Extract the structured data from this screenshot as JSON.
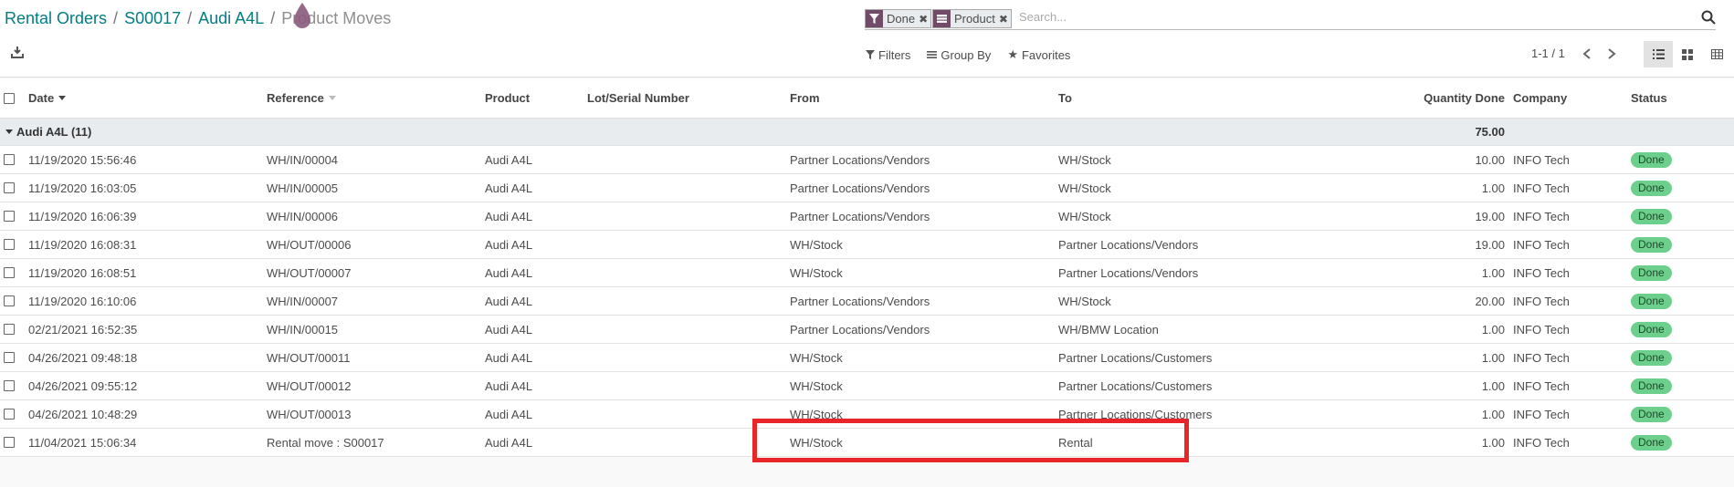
{
  "breadcrumb": {
    "items": [
      "Rental Orders",
      "S00017",
      "Audi A4L"
    ],
    "separator": "/",
    "current": "Product Moves"
  },
  "search": {
    "facets": [
      {
        "icon": "filter-icon",
        "label": "Done"
      },
      {
        "icon": "group-icon",
        "label": "Product"
      }
    ],
    "placeholder": "Search..."
  },
  "controls": {
    "filters": "Filters",
    "group_by": "Group By",
    "favorites": "Favorites",
    "pager": "1-1 / 1"
  },
  "table": {
    "columns": {
      "date": "Date",
      "reference": "Reference",
      "product": "Product",
      "lot": "Lot/Serial Number",
      "from": "From",
      "to": "To",
      "qty": "Quantity Done",
      "company": "Company",
      "status": "Status"
    },
    "group": {
      "label": "Audi A4L (11)",
      "total": "75.00"
    },
    "rows": [
      {
        "date": "11/19/2020 15:56:46",
        "reference": "WH/IN/00004",
        "product": "Audi A4L",
        "lot": "",
        "from": "Partner Locations/Vendors",
        "to": "WH/Stock",
        "qty": "10.00",
        "company": "INFO Tech",
        "status": "Done"
      },
      {
        "date": "11/19/2020 16:03:05",
        "reference": "WH/IN/00005",
        "product": "Audi A4L",
        "lot": "",
        "from": "Partner Locations/Vendors",
        "to": "WH/Stock",
        "qty": "1.00",
        "company": "INFO Tech",
        "status": "Done"
      },
      {
        "date": "11/19/2020 16:06:39",
        "reference": "WH/IN/00006",
        "product": "Audi A4L",
        "lot": "",
        "from": "Partner Locations/Vendors",
        "to": "WH/Stock",
        "qty": "19.00",
        "company": "INFO Tech",
        "status": "Done"
      },
      {
        "date": "11/19/2020 16:08:31",
        "reference": "WH/OUT/00006",
        "product": "Audi A4L",
        "lot": "",
        "from": "WH/Stock",
        "to": "Partner Locations/Vendors",
        "qty": "19.00",
        "company": "INFO Tech",
        "status": "Done"
      },
      {
        "date": "11/19/2020 16:08:51",
        "reference": "WH/OUT/00007",
        "product": "Audi A4L",
        "lot": "",
        "from": "WH/Stock",
        "to": "Partner Locations/Vendors",
        "qty": "1.00",
        "company": "INFO Tech",
        "status": "Done"
      },
      {
        "date": "11/19/2020 16:10:06",
        "reference": "WH/IN/00007",
        "product": "Audi A4L",
        "lot": "",
        "from": "Partner Locations/Vendors",
        "to": "WH/Stock",
        "qty": "20.00",
        "company": "INFO Tech",
        "status": "Done"
      },
      {
        "date": "02/21/2021 16:52:35",
        "reference": "WH/IN/00015",
        "product": "Audi A4L",
        "lot": "",
        "from": "Partner Locations/Vendors",
        "to": "WH/BMW Location",
        "qty": "1.00",
        "company": "INFO Tech",
        "status": "Done"
      },
      {
        "date": "04/26/2021 09:48:18",
        "reference": "WH/OUT/00011",
        "product": "Audi A4L",
        "lot": "",
        "from": "WH/Stock",
        "to": "Partner Locations/Customers",
        "qty": "1.00",
        "company": "INFO Tech",
        "status": "Done"
      },
      {
        "date": "04/26/2021 09:55:12",
        "reference": "WH/OUT/00012",
        "product": "Audi A4L",
        "lot": "",
        "from": "WH/Stock",
        "to": "Partner Locations/Customers",
        "qty": "1.00",
        "company": "INFO Tech",
        "status": "Done"
      },
      {
        "date": "04/26/2021 10:48:29",
        "reference": "WH/OUT/00013",
        "product": "Audi A4L",
        "lot": "",
        "from": "WH/Stock",
        "to": "Partner Locations/Customers",
        "qty": "1.00",
        "company": "INFO Tech",
        "status": "Done"
      },
      {
        "date": "11/04/2021 15:06:34",
        "reference": "Rental move : S00017",
        "product": "Audi A4L",
        "lot": "",
        "from": "WH/Stock",
        "to": "Rental",
        "qty": "1.00",
        "company": "INFO Tech",
        "status": "Done"
      }
    ]
  },
  "colors": {
    "accent": "#017e84",
    "brand": "#714b67",
    "done_badge": "#6ccf8b",
    "highlight": "#e8262a"
  }
}
